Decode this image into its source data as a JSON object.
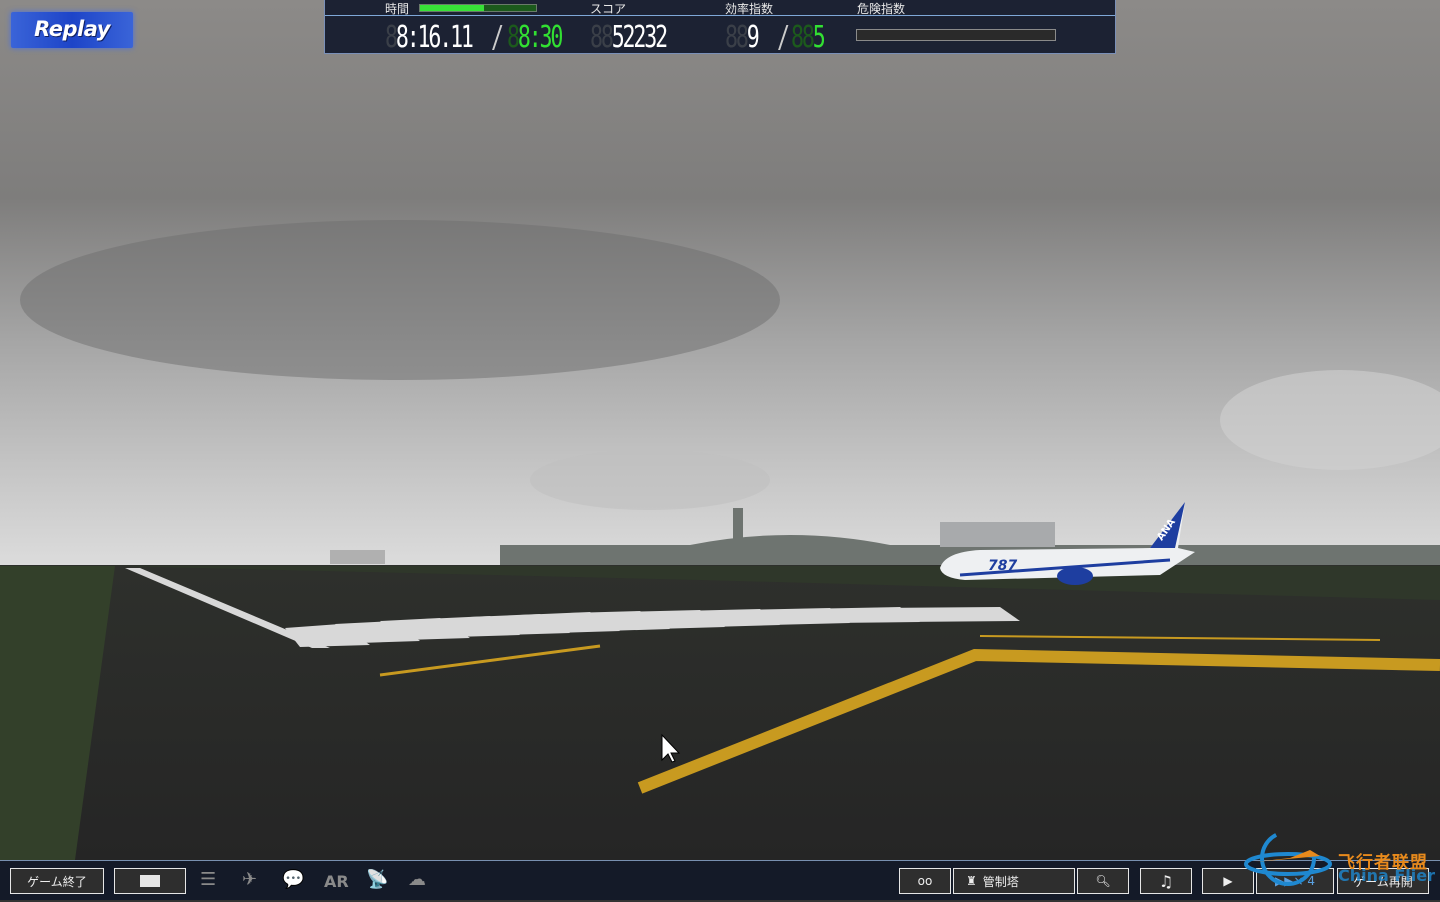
{
  "badge": {
    "label": "Replay"
  },
  "hud": {
    "time_label": "時間",
    "time_progress": 0.55,
    "time_current": "8:16.11",
    "time_sep": "/",
    "time_end": "8:30",
    "score_label": "スコア",
    "score": "52232",
    "efficiency_label": "効率指数",
    "efficiency": "9",
    "efficiency_sep": "/",
    "efficiency_max": "5",
    "danger_label": "危険指数",
    "danger_level": 0
  },
  "toolbar": {
    "quit": "ゲーム終了",
    "tower": "管制塔",
    "speed": "▶▶× 4",
    "resume": "ゲーム再開",
    "ar": "AR"
  },
  "watermark": {
    "cn": "飞行者联盟",
    "en": "China Flier"
  },
  "aircraft": {
    "livery": "ANA",
    "model": "787"
  },
  "colors": {
    "hud_bg": "#1c2233",
    "green": "#32e032",
    "bar_bg": "#141a28"
  }
}
